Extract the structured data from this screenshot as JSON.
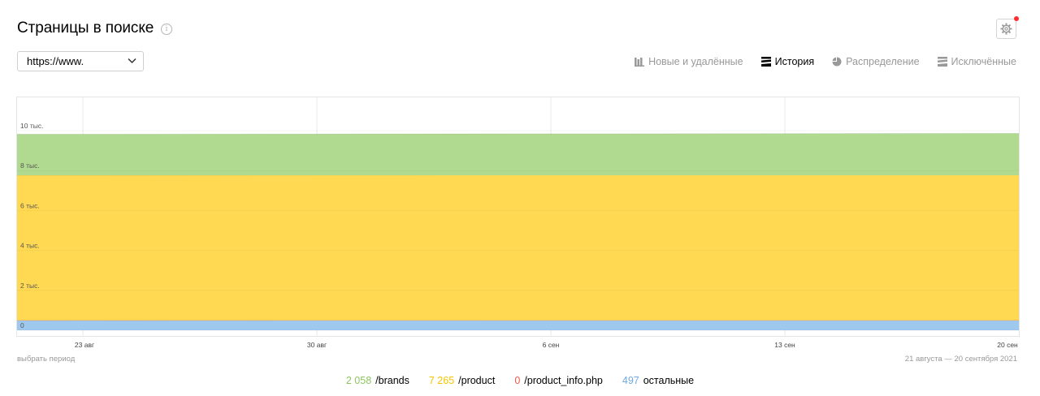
{
  "header": {
    "title": "Страницы в поиске",
    "info_icon": "info-icon",
    "settings_icon": "gear-icon"
  },
  "site_select": {
    "value": "https://www.",
    "icon": "chevron-down-icon"
  },
  "tabs": [
    {
      "label": "Новые и удалённые",
      "icon": "bars-icon",
      "active": false
    },
    {
      "label": "История",
      "icon": "stacked-layers-icon",
      "active": true
    },
    {
      "label": "Распределение",
      "icon": "pie-icon",
      "active": false
    },
    {
      "label": "Исключённые",
      "icon": "stacked-layers-icon",
      "active": false
    }
  ],
  "chart_data": {
    "type": "area",
    "stacked": true,
    "x": [
      "21 авг",
      "20 сен"
    ],
    "x_ticks": [
      "23 авг",
      "30 авг",
      "6 сен",
      "13 сен",
      "20 сен"
    ],
    "y_ticks": [
      "0",
      "2 тыс.",
      "4 тыс.",
      "6 тыс.",
      "8 тыс.",
      "10 тыс."
    ],
    "ylim": [
      0,
      12000
    ],
    "grid": true,
    "series": [
      {
        "name": "остальные",
        "values": [
          497,
          497
        ],
        "color": "#9fc8ee"
      },
      {
        "name": "/product_info.php",
        "values": [
          0,
          0
        ],
        "color": "#f25a4a"
      },
      {
        "name": "/product",
        "values": [
          7265,
          7265
        ],
        "color": "#ffd952"
      },
      {
        "name": "/brands",
        "values": [
          2058,
          2058
        ],
        "color": "#b1da91"
      }
    ]
  },
  "footer": {
    "period_link": "выбрать период",
    "period_range": "21 августа — 20 сентября 2021"
  },
  "legend": [
    {
      "value": "2 058",
      "label": "/brands",
      "color": "#8dc55f"
    },
    {
      "value": "7 265",
      "label": "/product",
      "color": "#f5c400"
    },
    {
      "value": "0",
      "label": "/product_info.php",
      "color": "#f25a4a"
    },
    {
      "value": "497",
      "label": "остальные",
      "color": "#6fa9e0"
    }
  ]
}
